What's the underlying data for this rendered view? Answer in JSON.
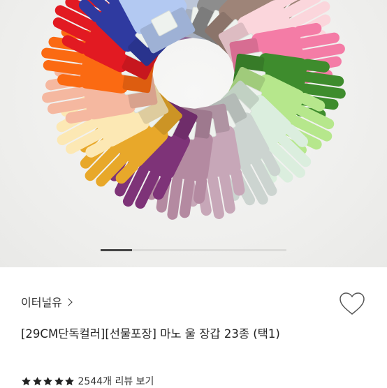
{
  "product": {
    "brand": "이터널유",
    "title": "[29CM단독컬러][선물포장] 마노 울 장갑 23종 (택1)",
    "rating_stars": 5,
    "review_summary": "2544개 리뷰 보기"
  },
  "gallery": {
    "current_index": 1,
    "progress_fraction": 0.17,
    "glove_colors": [
      "#a77fb0",
      "#bcc6d8",
      "#8d8d8d",
      "#9e8478",
      "#fbd6dc",
      "#f47ca6",
      "#3e8c2d",
      "#b6e78c",
      "#dbeede",
      "#ccd4d0",
      "#c7a7b8",
      "#b48aa1",
      "#7e3378",
      "#e8a82a",
      "#fce8b4",
      "#f5b8a0",
      "#fb6a12",
      "#e21a22",
      "#2f3aa0",
      "#b3c9f2"
    ]
  }
}
